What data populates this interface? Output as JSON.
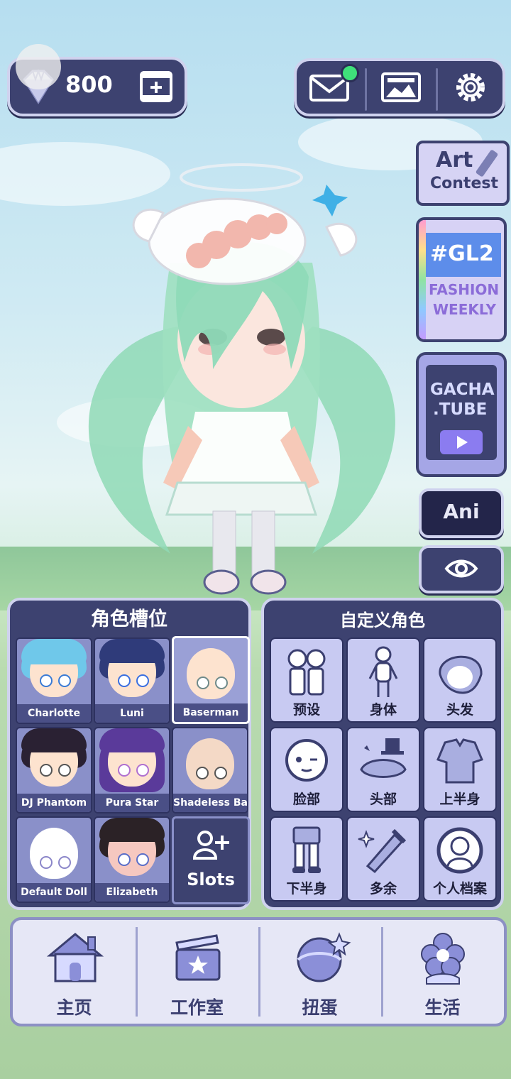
{
  "currency": {
    "gems": "800"
  },
  "top_right": {
    "mail_has_notification": true
  },
  "side": {
    "art_contest": {
      "line1": "Art",
      "line2": "Contest"
    },
    "gl2": {
      "tag": "#GL2",
      "line1": "FASHION",
      "line2": "WEEKLY"
    },
    "gacha_tube": {
      "line1": "GACHA",
      "line2": ".TUBE"
    },
    "ani_label": "Ani"
  },
  "slots_panel": {
    "title": "角色槽位",
    "slots": [
      {
        "name": "Charlotte",
        "hair": "#6fc8ea",
        "skin": "#fde3cf",
        "eye": "#3a7bd5"
      },
      {
        "name": "Luni",
        "hair": "#2f3b7a",
        "skin": "#fde3cf",
        "eye": "#3a6fe0"
      },
      {
        "name": "Baserman",
        "hair": "none",
        "skin": "#fde3cf",
        "eye": "#6f8a8a"
      },
      {
        "name": "DJ Phantom",
        "hair": "#2a2133",
        "skin": "#fde3cf",
        "eye": "#9a9a9a"
      },
      {
        "name": "Pura Star",
        "hair": "#5a3a9a",
        "skin": "#fde3cf",
        "eye": "#b070d0"
      },
      {
        "name": "Shadeless Bas",
        "hair": "none",
        "skin": "#f4d9c6",
        "eye": "#555555"
      },
      {
        "name": "Default Doll",
        "hair": "none",
        "skin": "#ffffff",
        "eye": "#8b86c9"
      },
      {
        "name": "Elizabeth",
        "hair": "#2b2226",
        "skin": "#f6c8c0",
        "eye": "#5a6ec8"
      }
    ],
    "add_slots_label": "Slots"
  },
  "customize_panel": {
    "title": "自定义角色",
    "items": [
      {
        "label": "预设",
        "icon": "preset-icon"
      },
      {
        "label": "身体",
        "icon": "body-icon"
      },
      {
        "label": "头发",
        "icon": "hair-icon"
      },
      {
        "label": "脸部",
        "icon": "face-icon"
      },
      {
        "label": "头部",
        "icon": "head-accessory-icon"
      },
      {
        "label": "上半身",
        "icon": "upper-body-icon"
      },
      {
        "label": "下半身",
        "icon": "lower-body-icon"
      },
      {
        "label": "多余",
        "icon": "extra-icon"
      },
      {
        "label": "个人档案",
        "icon": "profile-icon"
      }
    ]
  },
  "nav": [
    {
      "label": "主页",
      "icon": "home-icon"
    },
    {
      "label": "工作室",
      "icon": "studio-icon"
    },
    {
      "label": "扭蛋",
      "icon": "gacha-icon"
    },
    {
      "label": "生活",
      "icon": "life-icon"
    }
  ],
  "colors": {
    "panel": "#3d4270",
    "panel_border": "#cfd2ee",
    "accent_purple": "#8b7cf0",
    "nav_bg": "#e6e7f6"
  }
}
